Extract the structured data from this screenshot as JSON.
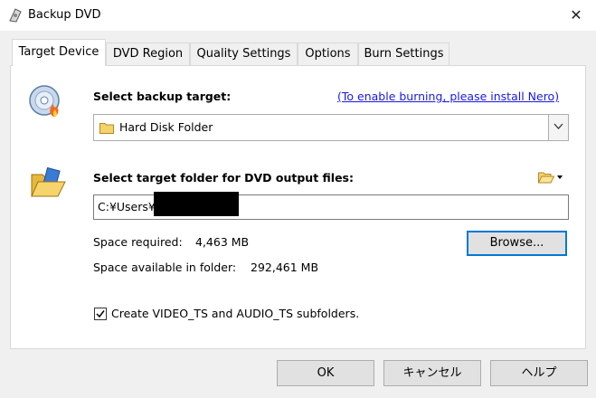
{
  "window": {
    "title": "Backup DVD",
    "close_glyph": "✕"
  },
  "tabs": [
    {
      "label": "Target Device",
      "active": true
    },
    {
      "label": "DVD Region",
      "active": false
    },
    {
      "label": "Quality Settings",
      "active": false
    },
    {
      "label": "Options",
      "active": false
    },
    {
      "label": "Burn Settings",
      "active": false
    }
  ],
  "target": {
    "heading": "Select backup target:",
    "nero_link": "(To enable burning, please install Nero)",
    "selected": "Hard Disk Folder"
  },
  "folder": {
    "heading": "Select target folder for DVD output files:",
    "path": "C:¥Users¥",
    "space_required_label": "Space required:",
    "space_required_value": "4,463 MB",
    "space_available_label": "Space available in folder:",
    "space_available_value": "292,461 MB",
    "browse_label": "Browse..."
  },
  "options": {
    "subfolders_label": "Create VIDEO_TS and AUDIO_TS subfolders.",
    "subfolders_checked": true
  },
  "buttons": {
    "ok": "OK",
    "cancel": "キャンセル",
    "help": "ヘルプ"
  },
  "icons": {
    "app": "dvd-app-icon",
    "disc": "dvd-burn-icon",
    "folder": "open-folder-icon",
    "folder_menu": "folder-dropdown-icon",
    "combo_folder": "folder-icon"
  },
  "colors": {
    "link": "#1a1adf",
    "default_button_border": "#0078d7",
    "redacted": "#000000"
  }
}
